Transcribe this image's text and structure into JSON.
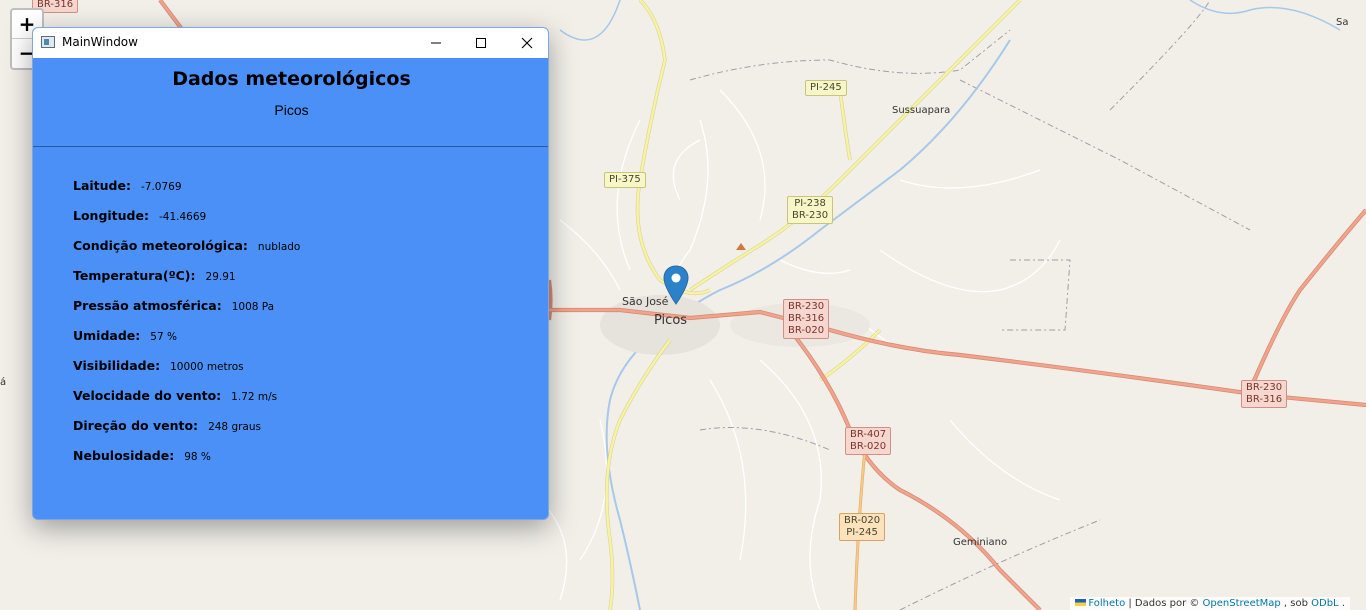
{
  "window": {
    "title": "MainWindow",
    "heading": "Dados meteorológicos",
    "city": "Picos"
  },
  "weather": [
    {
      "label": "Laitude:",
      "value": "-7.0769"
    },
    {
      "label": "Longitude:",
      "value": "-41.4669"
    },
    {
      "label": "Condição meteorológica:",
      "value": "nublado"
    },
    {
      "label": "Temperatura(ºC):",
      "value": "29.91"
    },
    {
      "label": "Pressão atmosférica:",
      "value": "1008 Pa"
    },
    {
      "label": "Umidade:",
      "value": "57 %"
    },
    {
      "label": "Visibilidade:",
      "value": "10000 metros"
    },
    {
      "label": "Velocidade do vento:",
      "value": "1.72 m/s"
    },
    {
      "label": "Direção do vento:",
      "value": "248 graus"
    },
    {
      "label": "Nebulosidade:",
      "value": "98 %"
    }
  ],
  "map": {
    "zoom_in": "+",
    "zoom_out": "−",
    "road_labels": {
      "br316_top": "BR-316",
      "pi245": "PI-245",
      "pi375": "PI-375",
      "pi238": "PI-238\nBR-230",
      "br230a": "BR-230\nBR-316\nBR-020",
      "br407": "BR-407\nBR-020",
      "br020": "BR-020\nPI-245",
      "br230b": "BR-230\nBR-316"
    },
    "places": {
      "sussuapara": "Sussuapara",
      "sao_jose": "São José",
      "picos": "Picos",
      "geminiano": "Geminiano",
      "edge_right": "Sa",
      "edge_left": "á"
    },
    "attribution": {
      "leaflet": "Folheto",
      "middle": " | Dados por © ",
      "osm": "OpenStreetMap",
      "sep": " , sob ",
      "license": "ODbL",
      "end": " ."
    }
  },
  "colors": {
    "panel_bg": "#4a90f7",
    "map_bg": "#f2efe9",
    "major_road": "#e8927c",
    "secondary_road": "#f3ef8f",
    "marker": "#2b82cb"
  }
}
